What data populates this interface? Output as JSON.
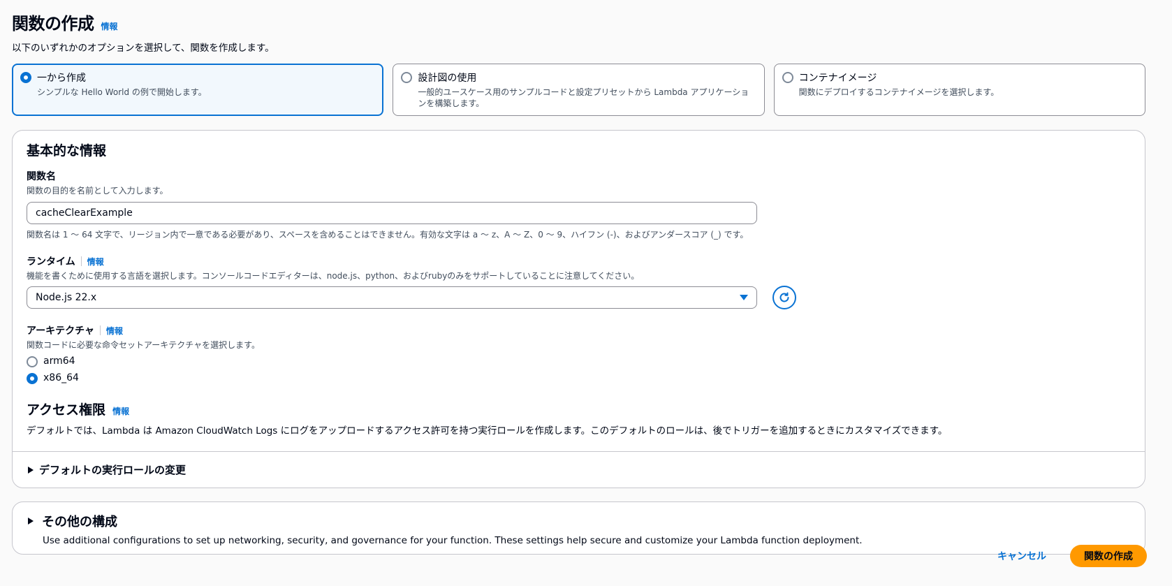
{
  "header": {
    "title": "関数の作成",
    "info": "情報",
    "description": "以下のいずれかのオプションを選択して、関数を作成します。"
  },
  "options": [
    {
      "title": "一から作成",
      "description": "シンプルな Hello World の例で開始します。",
      "selected": true
    },
    {
      "title": "設計図の使用",
      "description": "一般的ユースケース用のサンプルコードと設定プリセットから Lambda アプリケーションを構築します。",
      "selected": false
    },
    {
      "title": "コンテナイメージ",
      "description": "関数にデプロイするコンテナイメージを選択します。",
      "selected": false
    }
  ],
  "basic": {
    "title": "基本的な情報",
    "function_name": {
      "label": "関数名",
      "description": "関数の目的を名前として入力します。",
      "value": "cacheClearExample",
      "constraint": "関数名は 1 〜 64 文字で、リージョン内で一意である必要があり、スペースを含めることはできません。有効な文字は a 〜 z、A 〜 Z、0 〜 9、ハイフン (-)、およびアンダースコア (_) です。"
    },
    "runtime": {
      "label": "ランタイム",
      "info": "情報",
      "description": "機能を書くために使用する言語を選択します。コンソールコードエディターは、node.js、python、およびrubyのみをサポートしていることに注意してください。",
      "value": "Node.js 22.x"
    },
    "architecture": {
      "label": "アーキテクチャ",
      "info": "情報",
      "description": "関数コードに必要な命令セットアーキテクチャを選択します。",
      "options": [
        {
          "label": "arm64",
          "checked": false
        },
        {
          "label": "x86_64",
          "checked": true
        }
      ]
    },
    "access": {
      "title": "アクセス権限",
      "info": "情報",
      "description": "デフォルトでは、Lambda は Amazon CloudWatch Logs にログをアップロードするアクセス許可を持つ実行ロールを作成します。このデフォルトのロールは、後でトリガーを追加するときにカスタマイズできます。",
      "expander": "デフォルトの実行ロールの変更"
    }
  },
  "other": {
    "title": "その他の構成",
    "description": "Use additional configurations to set up networking, security, and governance for your function. These settings help secure and customize your Lambda function deployment."
  },
  "actions": {
    "cancel": "キャンセル",
    "create": "関数の作成"
  },
  "colors": {
    "accent": "#0972d3",
    "primary_button": "#ff9900"
  }
}
